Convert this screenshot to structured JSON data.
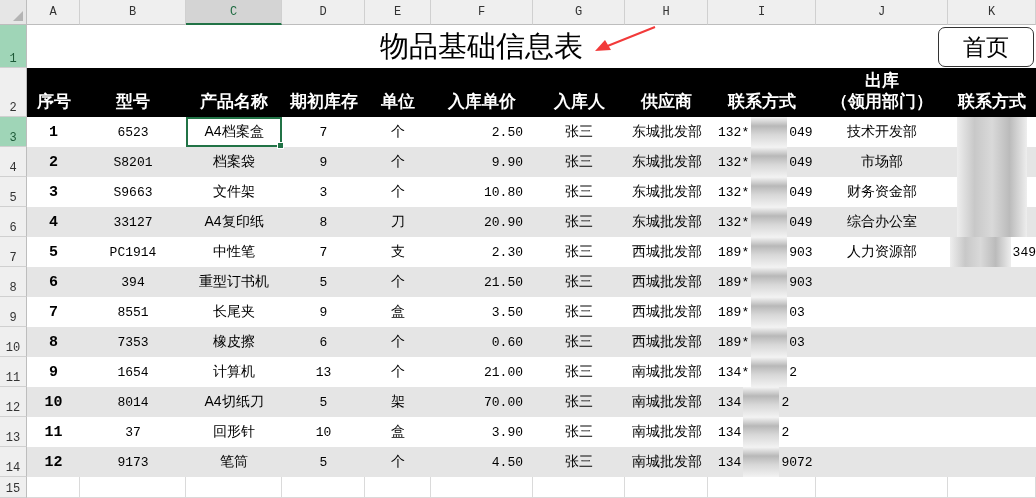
{
  "column_headers": [
    {
      "label": "A",
      "selected": false
    },
    {
      "label": "B",
      "selected": false
    },
    {
      "label": "C",
      "selected": true
    },
    {
      "label": "D",
      "selected": false
    },
    {
      "label": "E",
      "selected": false
    },
    {
      "label": "F",
      "selected": false
    },
    {
      "label": "G",
      "selected": false
    },
    {
      "label": "H",
      "selected": false
    },
    {
      "label": "I",
      "selected": false
    },
    {
      "label": "J",
      "selected": false
    },
    {
      "label": "K",
      "selected": false
    }
  ],
  "row_headers": [
    {
      "label": "1",
      "selected": true
    },
    {
      "label": "2",
      "selected": false
    },
    {
      "label": "3",
      "selected": true
    },
    {
      "label": "4",
      "selected": false
    },
    {
      "label": "5",
      "selected": false
    },
    {
      "label": "6",
      "selected": false
    },
    {
      "label": "7",
      "selected": false
    },
    {
      "label": "8",
      "selected": false
    },
    {
      "label": "9",
      "selected": false
    },
    {
      "label": "10",
      "selected": false
    },
    {
      "label": "11",
      "selected": false
    },
    {
      "label": "12",
      "selected": false
    },
    {
      "label": "13",
      "selected": false
    },
    {
      "label": "14",
      "selected": false
    },
    {
      "label": "15",
      "selected": false
    }
  ],
  "title": "物品基础信息表",
  "home_button": "首页",
  "header": [
    {
      "lines": [
        "序号"
      ]
    },
    {
      "lines": [
        "型号"
      ]
    },
    {
      "lines": [
        "产品名称"
      ]
    },
    {
      "lines": [
        "期初库存"
      ]
    },
    {
      "lines": [
        "单位"
      ]
    },
    {
      "lines": [
        "入库单价"
      ]
    },
    {
      "lines": [
        "入库人"
      ]
    },
    {
      "lines": [
        "供应商"
      ]
    },
    {
      "lines": [
        "联系方式"
      ]
    },
    {
      "lines": [
        "出库",
        "（领用部门）"
      ]
    },
    {
      "lines": [
        "联系方式"
      ]
    }
  ],
  "rows": [
    {
      "no": "1",
      "model": "6523",
      "name": "A4档案盒",
      "name_selected": true,
      "stock": "7",
      "unit": "个",
      "price": "2.50",
      "person": "张三",
      "supplier": "东城批发部",
      "phone_prefix": "132*",
      "phone_suffix": "049",
      "dept": "技术开发部",
      "contact_blurred": true
    },
    {
      "no": "2",
      "model": "S8201",
      "name": "档案袋",
      "name_selected": false,
      "stock": "9",
      "unit": "个",
      "price": "9.90",
      "person": "张三",
      "supplier": "东城批发部",
      "phone_prefix": "132*",
      "phone_suffix": "049",
      "dept": "市场部",
      "contact_blurred": true
    },
    {
      "no": "3",
      "model": "S9663",
      "name": "文件架",
      "name_selected": false,
      "stock": "3",
      "unit": "个",
      "price": "10.80",
      "person": "张三",
      "supplier": "东城批发部",
      "phone_prefix": "132*",
      "phone_suffix": "049",
      "dept": "财务资金部",
      "contact_blurred": true
    },
    {
      "no": "4",
      "model": "33127",
      "name": "A4复印纸",
      "name_selected": false,
      "stock": "8",
      "unit": "刀",
      "price": "20.90",
      "person": "张三",
      "supplier": "东城批发部",
      "phone_prefix": "132*",
      "phone_suffix": "049",
      "dept": "综合办公室",
      "contact_blurred": true
    },
    {
      "no": "5",
      "model": "PC1914",
      "name": "中性笔",
      "name_selected": false,
      "stock": "7",
      "unit": "支",
      "price": "2.30",
      "person": "张三",
      "supplier": "西城批发部",
      "phone_prefix": "189*",
      "phone_suffix": "903",
      "dept": "人力资源部",
      "contact_blurred": true,
      "contact_suffix": "349"
    },
    {
      "no": "6",
      "model": "394",
      "name": "重型订书机",
      "name_selected": false,
      "stock": "5",
      "unit": "个",
      "price": "21.50",
      "person": "张三",
      "supplier": "西城批发部",
      "phone_prefix": "189*",
      "phone_suffix": "903",
      "contact_blurred": false
    },
    {
      "no": "7",
      "model": "8551",
      "name": "长尾夹",
      "name_selected": false,
      "stock": "9",
      "unit": "盒",
      "price": "3.50",
      "person": "张三",
      "supplier": "西城批发部",
      "phone_prefix": "189*",
      "phone_suffix": "03",
      "contact_blurred": false
    },
    {
      "no": "8",
      "model": "7353",
      "name": "橡皮擦",
      "name_selected": false,
      "stock": "6",
      "unit": "个",
      "price": "0.60",
      "person": "张三",
      "supplier": "西城批发部",
      "phone_prefix": "189*",
      "phone_suffix": "03",
      "contact_blurred": false
    },
    {
      "no": "9",
      "model": "1654",
      "name": "计算机",
      "name_selected": false,
      "stock": "13",
      "unit": "个",
      "price": "21.00",
      "person": "张三",
      "supplier": "南城批发部",
      "phone_prefix": "134*",
      "phone_suffix": "2",
      "contact_blurred": false
    },
    {
      "no": "10",
      "model": "8014",
      "name": "A4切纸刀",
      "name_selected": false,
      "stock": "5",
      "unit": "架",
      "price": "70.00",
      "person": "张三",
      "supplier": "南城批发部",
      "phone_prefix": "134",
      "phone_suffix": "2",
      "contact_blurred": false
    },
    {
      "no": "11",
      "model": "37",
      "name": "回形针",
      "name_selected": false,
      "stock": "10",
      "unit": "盒",
      "price": "3.90",
      "person": "张三",
      "supplier": "南城批发部",
      "phone_prefix": "134",
      "phone_suffix": "2",
      "contact_blurred": false
    },
    {
      "no": "12",
      "model": "9173",
      "name": "笔筒",
      "name_selected": false,
      "stock": "5",
      "unit": "个",
      "price": "4.50",
      "person": "张三",
      "supplier": "南城批发部",
      "phone_prefix": "134",
      "phone_suffix": "9072",
      "contact_blurred": false
    }
  ]
}
